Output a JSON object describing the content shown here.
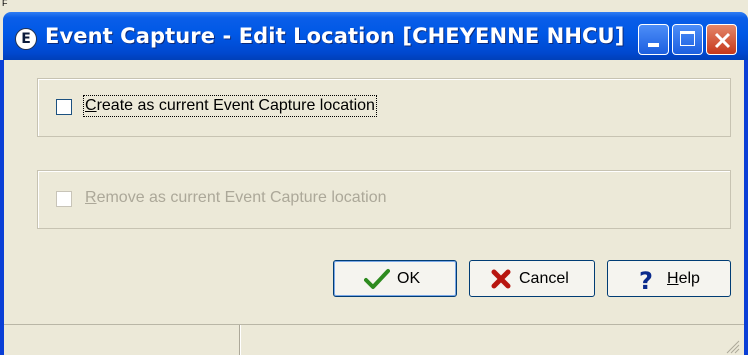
{
  "window": {
    "stray_mark": "F",
    "title": "Event Capture - Edit Location [CHEYENNE NHCU]",
    "app_icon_glyph": "E",
    "titlebar_color": "#0058e6",
    "close_color": "#c6381c"
  },
  "options": {
    "create": {
      "label_prefix": "",
      "label_accel": "C",
      "label_rest": "reate as current Event Capture location",
      "checked": false,
      "enabled": true
    },
    "remove": {
      "label_prefix": "",
      "label_accel": "R",
      "label_rest": "emove as current Event Capture location",
      "checked": false,
      "enabled": false
    }
  },
  "buttons": {
    "ok": {
      "label": "OK",
      "icon": "checkmark-icon",
      "icon_color": "#2e8b1f"
    },
    "cancel": {
      "label": "Cancel",
      "icon": "x-icon",
      "icon_color": "#b8160f"
    },
    "help": {
      "label_accel": "H",
      "label_rest": "elp",
      "icon": "question-icon",
      "icon_color": "#0a2a8c"
    }
  },
  "statusbar": {
    "panel1": "",
    "panel2": ""
  }
}
